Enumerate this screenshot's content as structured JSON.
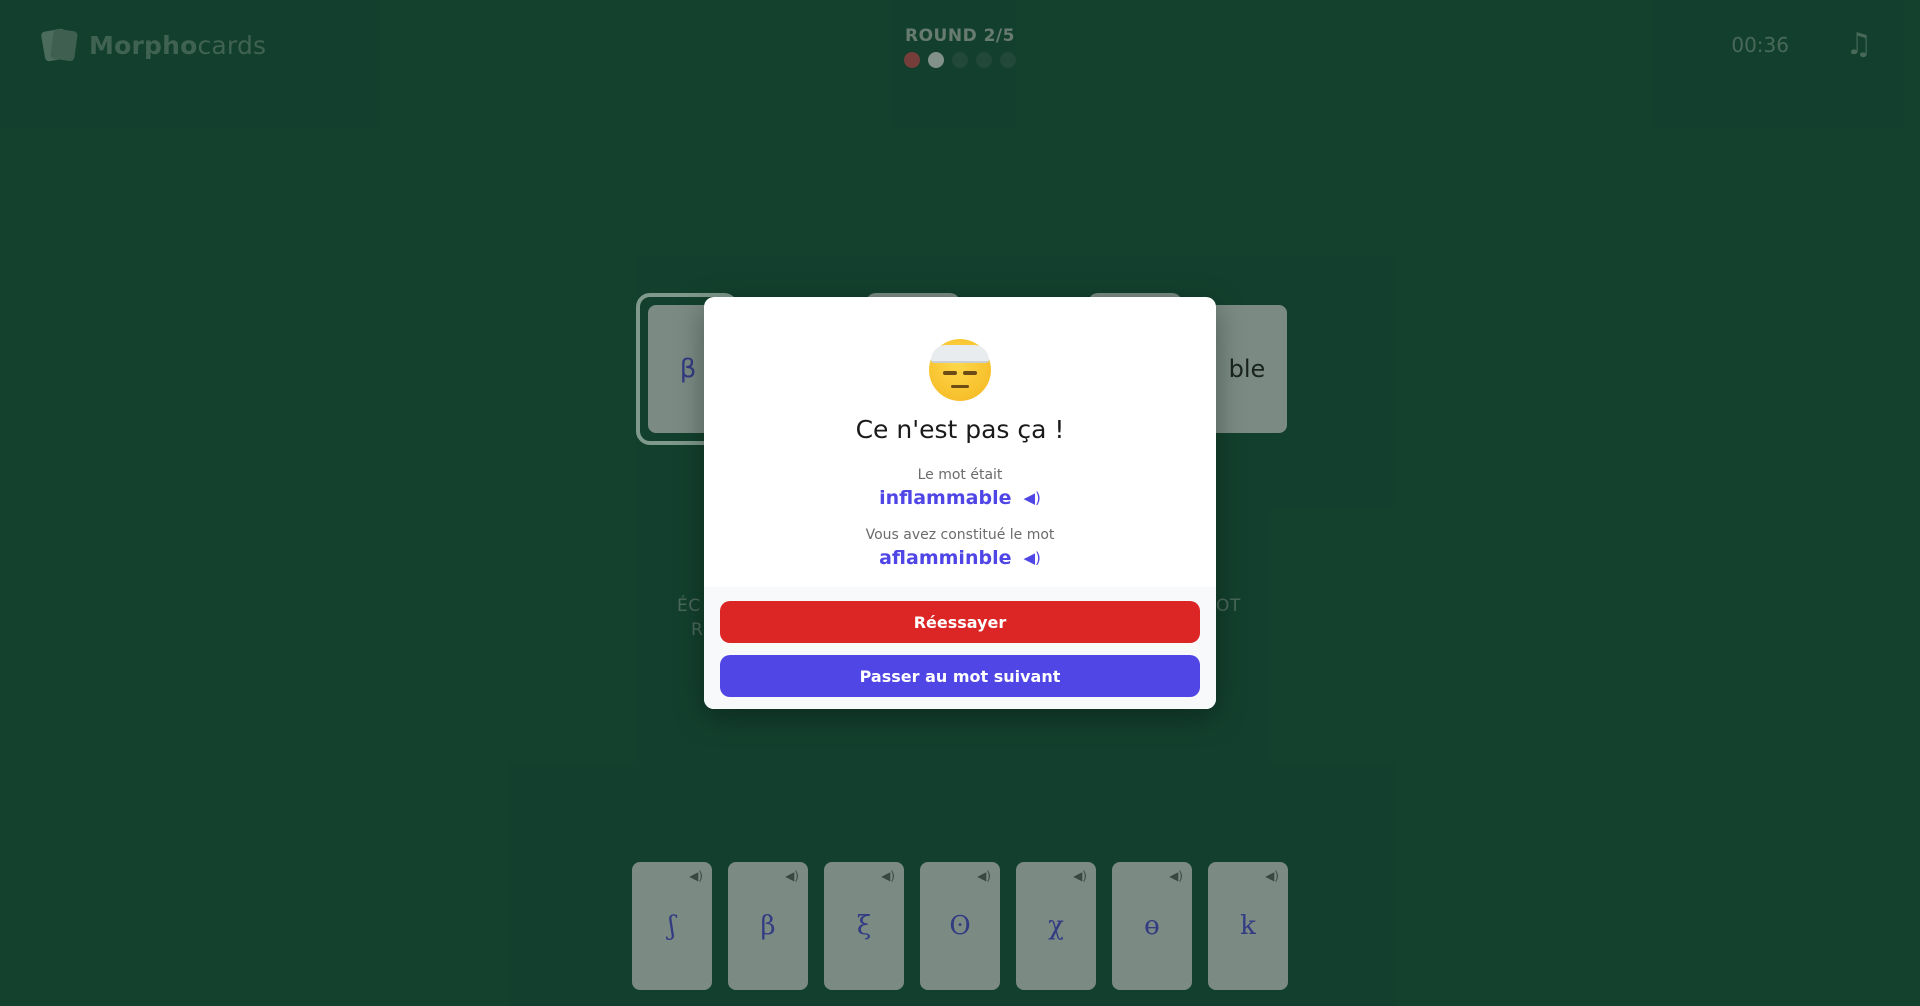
{
  "header": {
    "logo_bold": "Morpho",
    "logo_light": "cards",
    "round_label": "ROUND 2/5",
    "timer": "00:36",
    "music_icon": "music-note-icon",
    "rounds": [
      "fail",
      "current",
      "pending",
      "pending",
      "pending"
    ]
  },
  "board": {
    "slot1_symbol": "β",
    "slot_last_text": "ble",
    "hint_left_line1": "ÉC",
    "hint_left_line2": "R",
    "hint_right": "OT"
  },
  "hand": {
    "cards": [
      {
        "symbol": "ʃ"
      },
      {
        "symbol": "β"
      },
      {
        "symbol": "ξ"
      },
      {
        "symbol": "ʘ"
      },
      {
        "symbol": "χ"
      },
      {
        "symbol": "ɵ"
      },
      {
        "symbol": "k"
      }
    ],
    "speaker_icon": "speaker-icon"
  },
  "modal": {
    "emoji": "face-with-head-bandage",
    "title": "Ce n'est pas ça !",
    "correct_label": "Le mot était",
    "correct_word": "inflammable",
    "built_label": "Vous avez constitué le mot",
    "built_word": "aflamminble",
    "retry_label": "Réessayer",
    "next_label": "Passer au mot suivant",
    "colors": {
      "retry": "#dc2626",
      "next": "#4f46e5",
      "word": "#4f46e5"
    }
  }
}
